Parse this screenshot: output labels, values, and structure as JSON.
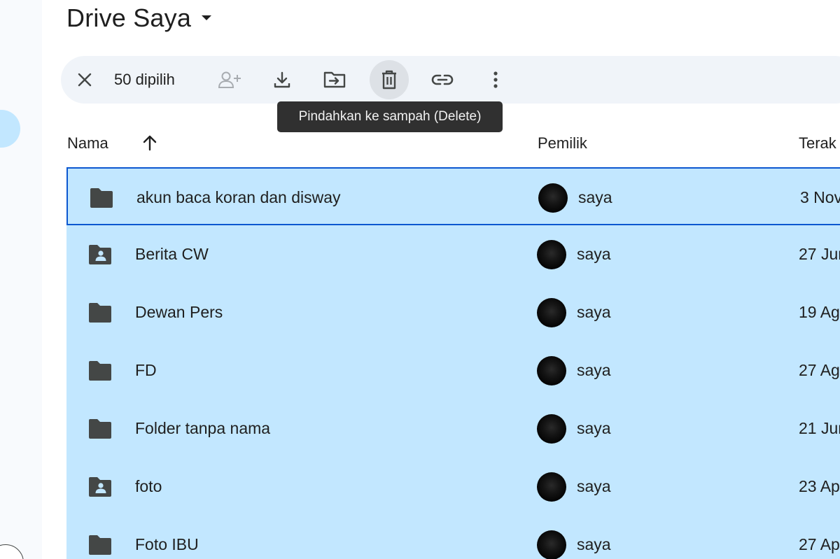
{
  "page": {
    "title": "Drive Saya"
  },
  "toolbar": {
    "selected_count": "50 dipilih",
    "buttons": [
      {
        "name": "clear-selection",
        "icon": "close-icon"
      },
      {
        "name": "share",
        "icon": "person-add-icon",
        "disabled": true
      },
      {
        "name": "download",
        "icon": "download-icon"
      },
      {
        "name": "move",
        "icon": "move-folder-icon"
      },
      {
        "name": "trash",
        "icon": "trash-icon",
        "active": true
      },
      {
        "name": "copy-link",
        "icon": "link-icon"
      },
      {
        "name": "more",
        "icon": "more-vertical-icon"
      }
    ]
  },
  "tooltip": {
    "text": "Pindahkan ke sampah (Delete)"
  },
  "columns": {
    "name": "Nama",
    "owner": "Pemilik",
    "modified": "Terak"
  },
  "files": [
    {
      "name": "akun baca koran dan disway",
      "icon": "folder-icon",
      "owner": "saya",
      "modified": "3 Nov"
    },
    {
      "name": "Berita CW",
      "icon": "shared-folder-icon",
      "owner": "saya",
      "modified": "27 Jun"
    },
    {
      "name": "Dewan Pers",
      "icon": "folder-icon",
      "owner": "saya",
      "modified": "19 Ag"
    },
    {
      "name": "FD",
      "icon": "folder-icon",
      "owner": "saya",
      "modified": "27 Ag"
    },
    {
      "name": "Folder tanpa nama",
      "icon": "folder-icon",
      "owner": "saya",
      "modified": "21 Jun"
    },
    {
      "name": "foto",
      "icon": "shared-folder-icon",
      "owner": "saya",
      "modified": "23 Ap"
    },
    {
      "name": "Foto IBU",
      "icon": "folder-icon",
      "owner": "saya",
      "modified": "27 Ap"
    }
  ],
  "colors": {
    "selection": "#c2e7ff",
    "focus_border": "#0b57d0",
    "toolbar_bg": "#f0f4f9",
    "tooltip_bg": "#303030"
  }
}
